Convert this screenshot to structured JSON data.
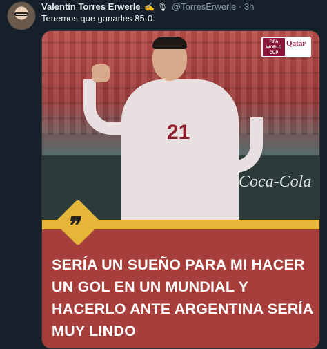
{
  "tweet": {
    "author_name": "Valentín Torres Erwerle",
    "author_badges": [
      "✍",
      "🎙"
    ],
    "handle": "@TorresErwerle",
    "separator": "·",
    "time": "3h",
    "text": "Tenemos que ganarles 85-0."
  },
  "media": {
    "board_text": "Coca-Cola",
    "jersey_number": "21",
    "logo": {
      "fifa": "FIFA WORLD CUP",
      "qatar": "Qatar"
    },
    "quote_symbol": "❞",
    "headline": "SERÍA UN SUEÑO PARA MI HACER UN GOL EN UN MUNDIAL Y HACERLO ANTE ARGENTINA SERÍA MUY LINDO"
  }
}
